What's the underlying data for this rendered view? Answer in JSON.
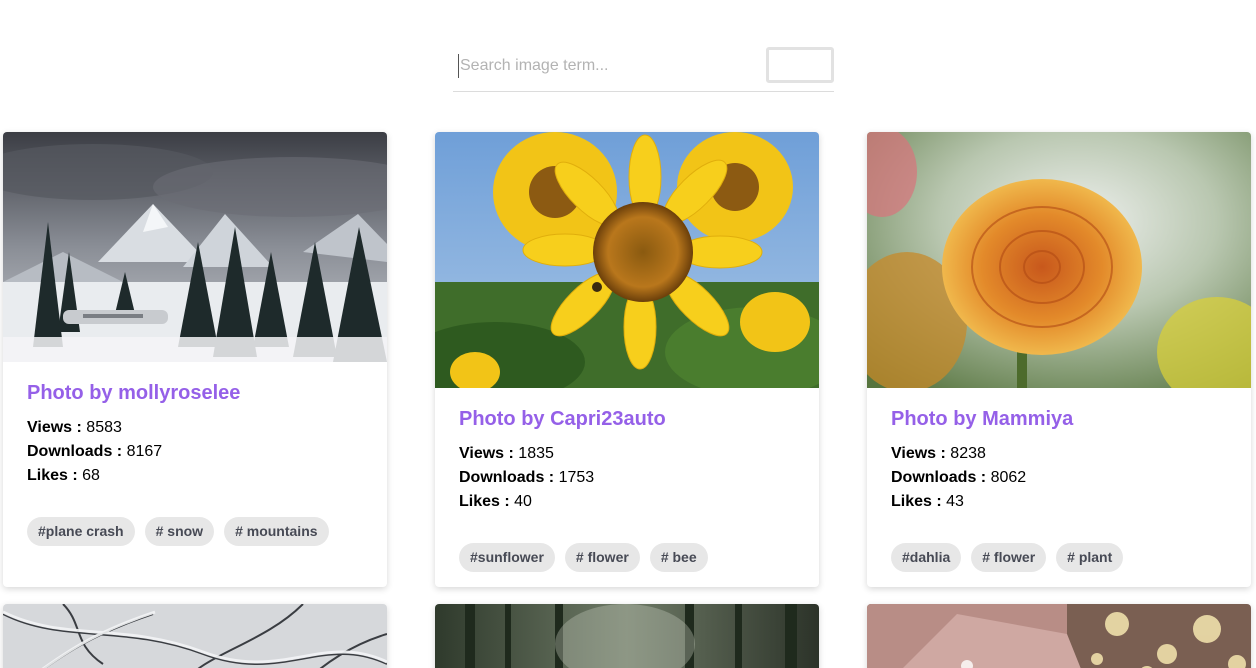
{
  "search": {
    "placeholder": "Search image term...",
    "value": ""
  },
  "cards": [
    {
      "title": "Photo by mollyroselee",
      "stats": [
        {
          "label": "Views :",
          "value": "8583"
        },
        {
          "label": "Downloads :",
          "value": "8167"
        },
        {
          "label": "Likes :",
          "value": "68"
        }
      ],
      "tags": [
        "#plane crash",
        "# snow",
        "# mountains"
      ]
    },
    {
      "title": "Photo by Capri23auto",
      "stats": [
        {
          "label": "Views :",
          "value": "1835"
        },
        {
          "label": "Downloads :",
          "value": "1753"
        },
        {
          "label": "Likes :",
          "value": "40"
        }
      ],
      "tags": [
        "#sunflower",
        "# flower",
        "# bee"
      ]
    },
    {
      "title": "Photo by Mammiya",
      "stats": [
        {
          "label": "Views :",
          "value": "8238"
        },
        {
          "label": "Downloads :",
          "value": "8062"
        },
        {
          "label": "Likes :",
          "value": "43"
        }
      ],
      "tags": [
        "#dahlia",
        "# flower",
        "# plant"
      ]
    }
  ],
  "colors": {
    "title": "#9560e8",
    "tag_bg": "#e7e7e7",
    "tag_text": "#474a55"
  },
  "images": [
    "mountain-snow-photo",
    "sunflower-photo",
    "dahlia-photo",
    "snowy-branches-photo",
    "forest-photo",
    "bokeh-crystal-photo"
  ]
}
